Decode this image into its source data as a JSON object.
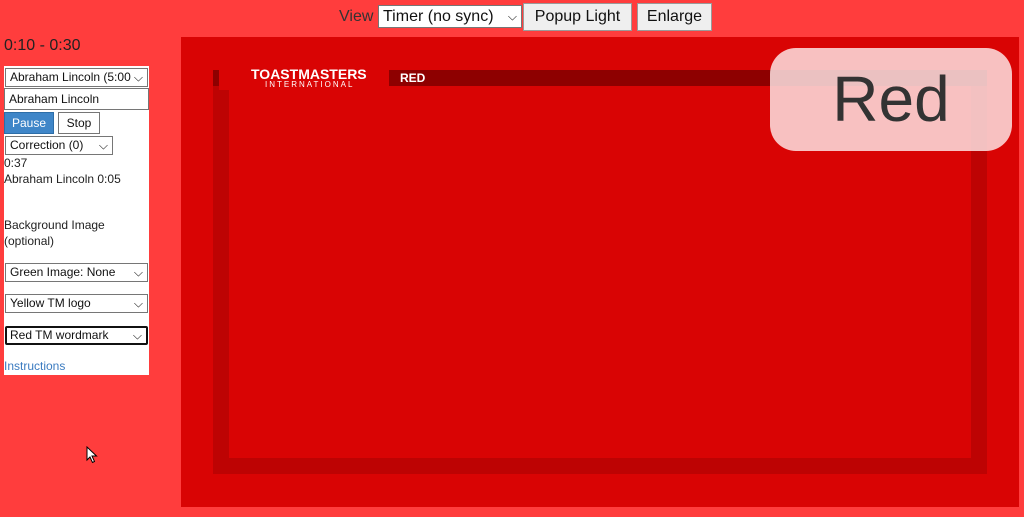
{
  "topbar": {
    "view_label": "View",
    "view_selected": "Timer (no sync)",
    "popup_label": "Popup Light",
    "enlarge_label": "Enlarge"
  },
  "time_range": "0:10 - 0:30",
  "panel": {
    "speaker_select": "Abraham Lincoln (5:00",
    "name_input": "Abraham Lincoln",
    "pause_label": "Pause",
    "stop_label": "Stop",
    "correction_select": "Correction (0)",
    "elapsed": "0:37",
    "log_entry": "Abraham Lincoln 0:05",
    "bg_label_line1": "Background Image",
    "bg_label_line2": "(optional)",
    "green_select": "Green Image: None",
    "yellow_select": "Yellow TM logo",
    "red_select": "Red TM wordmark",
    "instructions_link": "Instructions"
  },
  "stage": {
    "logo_word": "TOASTMASTERS",
    "logo_sub": "INTERNATIONAL",
    "color_tag": "RED",
    "status_text": "Red"
  },
  "colors": {
    "page_bg": "#ff3d3d",
    "stage_bg": "#d90404",
    "frame": "#bd0303",
    "pause_button": "#3f86c8",
    "link": "#3b7bc0"
  },
  "icons": {
    "dropdown": "chevron-down-icon",
    "cursor": "mouse-cursor-icon"
  }
}
